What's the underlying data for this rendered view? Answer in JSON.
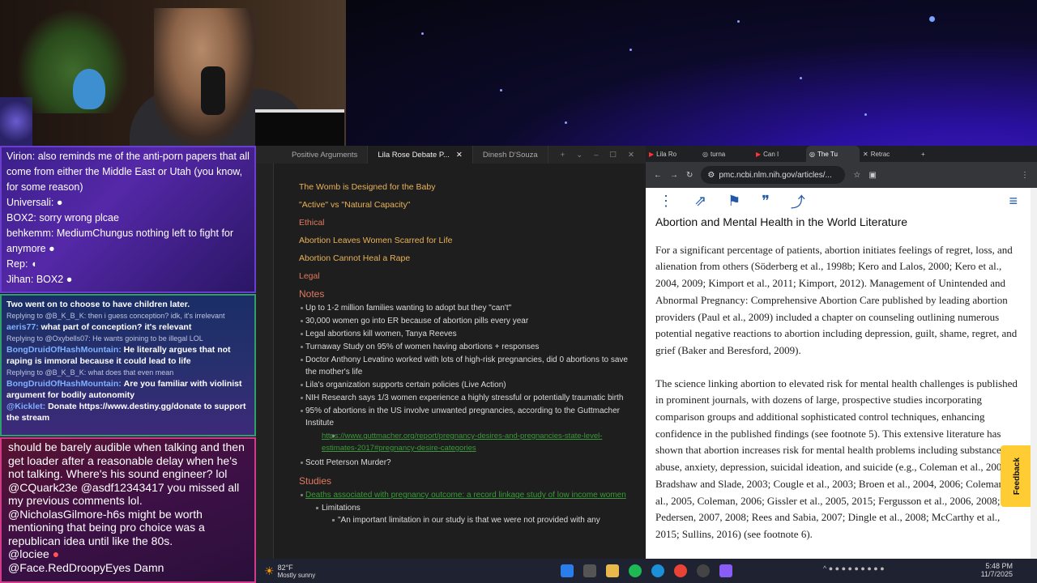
{
  "chat": {
    "top": [
      {
        "user": "Virion",
        "text": "also reminds me of the anti-porn papers that all come from either the Middle East or Utah (you know, for some reason)"
      },
      {
        "user": "Universali",
        "text": ""
      },
      {
        "user": "BOX2",
        "text": "sorry wrong plcae"
      },
      {
        "user": "behkemm",
        "text": "MediumChungus nothing left to fight for anymore"
      },
      {
        "user": "Rep",
        "text": ""
      },
      {
        "user": "Jihan",
        "text": "BOX2"
      }
    ],
    "mid": {
      "line1": "Two went on to choose to have children later.",
      "reply1": "Replying to @B_K_B_K: then i guess conception? idk, it's irrelevant",
      "msg1_user": "aeris77:",
      "msg1_text": "what part of conception? it's relevant",
      "reply2": "Replying to @Oxybells07: He wants goining to be illegal LOL",
      "msg2_user": "BongDruidOfHashMountain:",
      "msg2_text": "He literally argues that not raping is immoral because it could lead to life",
      "reply3": "Replying to @B_K_B_K: what does that even mean",
      "msg3_user": "BongDruidOfHashMountain:",
      "msg3_text": "Are you familiar with violinist argument for bodily autonomity",
      "msg4_user": "@Kicklet:",
      "msg4_text": "Donate https://www.destiny.gg/donate to support the stream"
    },
    "bottom": [
      {
        "user": "",
        "text": "should be barely audible when talking and then get loader after a reasonable delay when he's not talking. Where's his sound engineer? lol"
      },
      {
        "user": "@CQuark23e",
        "text": "@asdf12343417 you missed all my previous comments lol."
      },
      {
        "user": "@NicholasGilmore-h6s",
        "text": "might be worth mentioning that being pro choice was a republican idea until like the 80s."
      },
      {
        "user": "@lociee",
        "text": ""
      },
      {
        "user": "@Face.RedDroopyEyes",
        "text": "Damn"
      }
    ]
  },
  "obsidian": {
    "tabs": [
      "Positive Arguments",
      "Lila Rose Debate P...",
      "Dinesh D'Souza"
    ],
    "headings": [
      "The Womb is Designed for the Baby",
      "\"Active\" vs \"Natural Capacity\"",
      "Ethical",
      "Abortion Leaves Women Scarred for Life",
      "Abortion Cannot Heal a Rape",
      "Legal"
    ],
    "notes_title": "Notes",
    "notes": [
      "Up to 1-2 million families wanting to adopt but they \"can't\"",
      "30,000 women go into ER because of abortion pills every year",
      "Legal abortions kill women, Tanya Reeves",
      "Turnaway Study on 95% of women having abortions + responses",
      "Doctor Anthony Levatino worked with lots of high-risk pregnancies, did 0 abortions to save the mother's life",
      "Lila's organization supports certain policies (Live Action)",
      "NIH Research says 1/3 women experience a highly stressful or potentially traumatic birth",
      "95% of abortions in the US involve unwanted pregnancies, according to the Guttmacher Institute"
    ],
    "note_link": "https://www.guttmacher.org/report/pregnancy-desires-and-pregnancies-state-level-estimates-2017#pregnancy-desire-categories",
    "last_note": "Scott Peterson Murder?",
    "studies_title": "Studies",
    "study_link": "Deaths associated with pregnancy outcome: a record linkage study of low income women",
    "limitations": "Limitations",
    "quote": "\"An important limitation in our study is that we were not provided with any"
  },
  "chrome": {
    "tabs": [
      "Lila Ro",
      "turna",
      "Can I",
      "The Tu",
      "Retrac"
    ],
    "url": "pmc.ncbi.nlm.nih.gov/articles/...",
    "article_title": "Abortion and Mental Health in the World Literature",
    "p1": "For a significant percentage of patients, abortion initiates feelings of regret, loss, and alienation from others (Söderberg et al., 1998b; Kero and Lalos, 2000; Kero et al., 2004, 2009; Kimport et al., 2011; Kimport, 2012). Management of Unintended and Abnormal Pregnancy: Comprehensive Abortion Care published by leading abortion providers (Paul et al., 2009) included a chapter on counseling outlining numerous potential negative reactions to abortion including depression, guilt, shame, regret, and grief (Baker and Beresford, 2009).",
    "p2": "The science linking abortion to elevated risk for mental health challenges is published in prominent journals, with dozens of large, prospective studies incorporating comparison groups and additional sophisticated control techniques, enhancing confidence in the published findings (see footnote 5). This extensive literature has shown that abortion increases risk for mental health problems including substance abuse, anxiety, depression, suicidal ideation, and suicide (e.g., Coleman et al., 2002a; Bradshaw and Slade, 2003; Cougle et al., 2003; Broen et al., 2004, 2006; Coleman et al., 2005, Coleman, 2006; Gissler et al., 2005, 2015; Fergusson et al., 2006, 2008; Pedersen, 2007, 2008; Rees and Sabia, 2007; Dingle et al., 2008; McCarthy et al., 2015; Sullins, 2016) (see footnote 6).",
    "feedback": "Feedback"
  },
  "taskbar": {
    "temp": "82°F",
    "weather": "Mostly sunny",
    "time": "5:48 PM",
    "date": "11/7/2025"
  },
  "colors": {
    "accent": "#2159a8",
    "obsidian_heading": "#e8b25a",
    "obsidian_section": "#e07a5f",
    "link": "#205493"
  }
}
